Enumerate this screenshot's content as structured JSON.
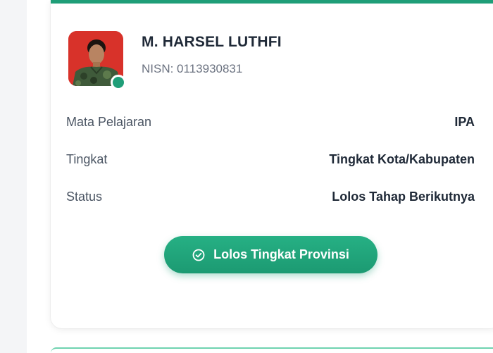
{
  "student": {
    "name": "M. HARSEL LUTHFI",
    "nisn": "NISN: 0113930831",
    "photo_icon": "student-photo",
    "status_indicator_color": "#1f9e78"
  },
  "details": [
    {
      "label": "Mata Pelajaran",
      "value": "IPA"
    },
    {
      "label": "Tingkat",
      "value": "Tingkat Kota/Kabupaten"
    },
    {
      "label": "Status",
      "value": "Lolos Tahap Berikutnya"
    }
  ],
  "result_button": {
    "label": "Lolos Tingkat Provinsi",
    "icon": "check-circle-icon",
    "color": "#1f9e78"
  },
  "theme": {
    "accent": "#1f9e78"
  }
}
